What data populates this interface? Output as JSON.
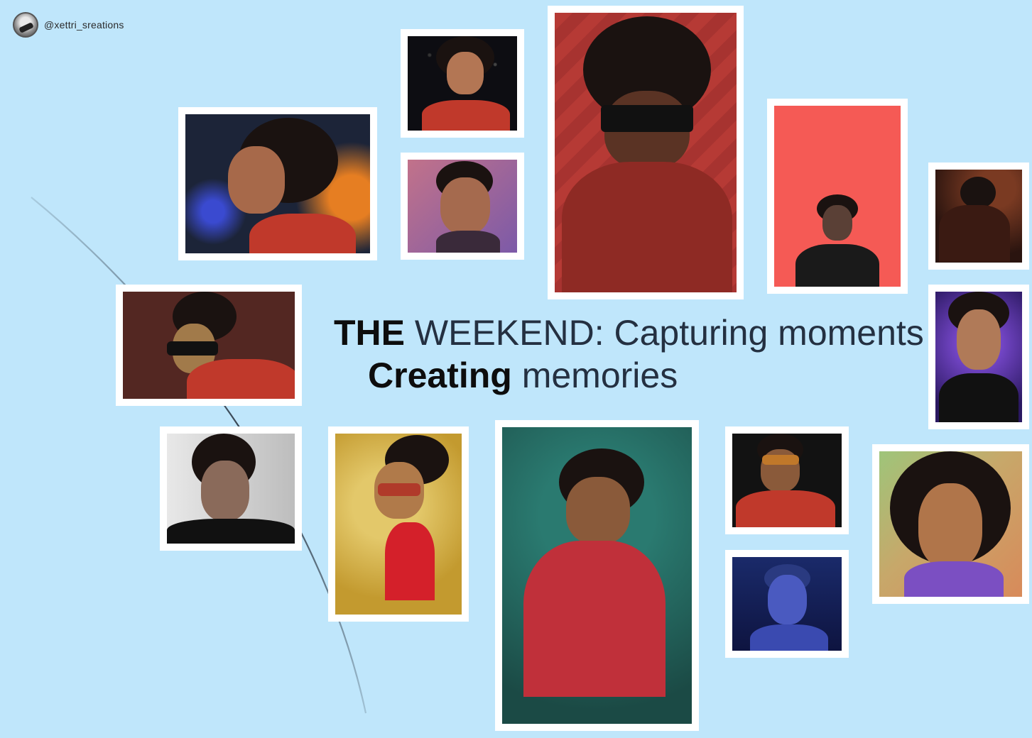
{
  "watermark": {
    "handle": "@xettri_sreations",
    "avatar_icon": "user-avatar-icon"
  },
  "headline": {
    "line1_bold": "THE",
    "line1_rest": "WEEKEND: Capturing moments",
    "line2_bold": "Creating",
    "line2_rest": "memories"
  },
  "colors": {
    "background": "#bfe6fb",
    "frame": "#ffffff",
    "arc": "#2a3542",
    "text": "#1f2d3d"
  },
  "artworks": [
    {
      "id": "profile-side-red-jacket",
      "palette": [
        "#1c2438",
        "#c0392b",
        "#e67e22"
      ]
    },
    {
      "id": "smoking-space-red-suit",
      "palette": [
        "#0d0d12",
        "#c0392b",
        "#b37654"
      ]
    },
    {
      "id": "cartoon-pink-purple",
      "palette": [
        "#c2728a",
        "#7c5aa8",
        "#3a2a3a"
      ]
    },
    {
      "id": "sunglasses-red-stripes",
      "palette": [
        "#b63a35",
        "#1a1210",
        "#5a2a20"
      ]
    },
    {
      "id": "coral-poster",
      "palette": [
        "#f55a55",
        "#1a1a1a",
        "#ffffff"
      ]
    },
    {
      "id": "dark-dance",
      "palette": [
        "#2a140f",
        "#7a3a22",
        "#1a1210"
      ]
    },
    {
      "id": "glitter-glasses-maroon",
      "palette": [
        "#532722",
        "#1a1210",
        "#c0392b"
      ]
    },
    {
      "id": "galaxy-suit-portrait",
      "palette": [
        "#4b2a86",
        "#111111",
        "#a7694a"
      ]
    },
    {
      "id": "black-white-sketch",
      "palette": [
        "#f2f2f2",
        "#111111",
        "#8a6a5a"
      ]
    },
    {
      "id": "caricature-microphone",
      "palette": [
        "#c39a2f",
        "#d4202a",
        "#1a1210"
      ]
    },
    {
      "id": "teal-confetti-stage",
      "palette": [
        "#1f5e57",
        "#c0303a",
        "#1a1210"
      ]
    },
    {
      "id": "smoke-red-jacket-dark",
      "palette": [
        "#121212",
        "#c0392b",
        "#1a1210"
      ]
    },
    {
      "id": "blue-car-night",
      "palette": [
        "#1a2a6a",
        "#3a4ab0",
        "#a7b0e0"
      ]
    },
    {
      "id": "3d-purple-suit",
      "palette": [
        "#c7a86a",
        "#7b4fc2",
        "#1a1210"
      ]
    }
  ]
}
